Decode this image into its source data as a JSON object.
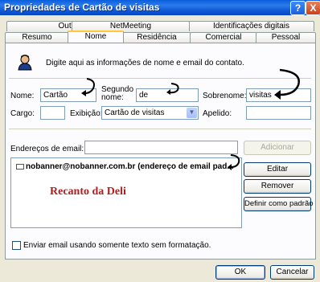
{
  "window": {
    "title": "Propriedades de Cartão de visitas",
    "help_symbol": "?",
    "close_symbol": "X"
  },
  "tabs_row1": [
    {
      "label": "Outras"
    },
    {
      "label": "NetMeeting"
    },
    {
      "label": "Identificações digitais"
    }
  ],
  "tabs_row2": [
    {
      "label": "Resumo"
    },
    {
      "label": "Nome",
      "active": true
    },
    {
      "label": "Residência"
    },
    {
      "label": "Comercial"
    },
    {
      "label": "Pessoal"
    }
  ],
  "intro": {
    "icon": "person-icon",
    "text": "Digite aqui as informações de nome e email do contato."
  },
  "name_fields": {
    "first_label": "Nome:",
    "first_value": "Cartão",
    "middle_label_1": "Segundo",
    "middle_label_2": "nome:",
    "middle_value": "de",
    "last_label": "Sobrenome:",
    "last_value": "visitas"
  },
  "row2": {
    "title_label": "Cargo:",
    "title_value": "",
    "display_label": "Exibição:",
    "display_value": "Cartão de visitas",
    "nickname_label": "Apelido:",
    "nickname_value": ""
  },
  "email": {
    "label": "Endereços de email:",
    "input_value": "",
    "add_button": "Adicionar",
    "list_item": "nobanner@nobanner.com.br  (endereço de email pad...",
    "watermark": "Recanto da Deli"
  },
  "side_buttons": {
    "edit": "Editar",
    "remove": "Remover",
    "set_default": "Definir como padrão"
  },
  "plain_text_checkbox": {
    "checked": false,
    "label": "Enviar email usando somente texto sem formatação."
  },
  "footer": {
    "ok": "OK",
    "cancel": "Cancelar"
  },
  "colors": {
    "accent": "#0A5EDC",
    "watermark": "#B01E1E",
    "tab_highlight": "#FFC83C"
  }
}
